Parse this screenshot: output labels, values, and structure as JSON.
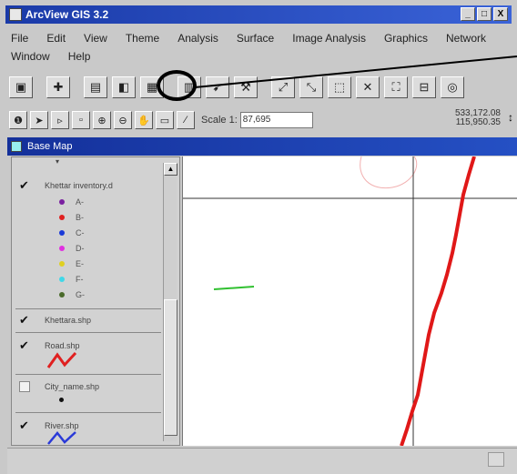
{
  "window": {
    "title": "ArcView GIS 3.2",
    "buttons": {
      "minimize": "_",
      "maximize": "□",
      "close": "X"
    }
  },
  "menu": [
    "File",
    "Edit",
    "View",
    "Theme",
    "Analysis",
    "Surface",
    "Image Analysis",
    "Graphics",
    "Network",
    "Window",
    "Help"
  ],
  "toolbar": {
    "buttons": [
      {
        "name": "save-icon",
        "glyph": "▣"
      },
      {
        "name": "add-theme-icon",
        "glyph": "✚"
      },
      {
        "name": "theme-properties-icon",
        "glyph": "▤"
      },
      {
        "name": "edit-legend-icon",
        "glyph": "◧"
      },
      {
        "name": "open-theme-table-icon",
        "glyph": "▦"
      },
      {
        "name": "find-icon",
        "glyph": "▥"
      },
      {
        "name": "locate-address-icon",
        "glyph": "➹"
      },
      {
        "name": "query-builder-icon",
        "glyph": "⚒"
      },
      {
        "name": "zoom-full-extent-icon",
        "glyph": "⤢"
      },
      {
        "name": "zoom-to-themes-icon",
        "glyph": "⤡"
      },
      {
        "name": "zoom-to-selected-icon",
        "glyph": "⬚"
      },
      {
        "name": "zoom-in-icon",
        "glyph": "✕"
      },
      {
        "name": "zoom-out-icon",
        "glyph": "⛶"
      },
      {
        "name": "zoom-previous-icon",
        "glyph": "⊟"
      },
      {
        "name": "select-none-icon",
        "glyph": "◎"
      }
    ]
  },
  "tools": [
    {
      "name": "identify-icon",
      "glyph": "❶"
    },
    {
      "name": "pointer-icon",
      "glyph": "➤"
    },
    {
      "name": "vertex-edit-icon",
      "glyph": "▹"
    },
    {
      "name": "select-feature-icon",
      "glyph": "▫"
    },
    {
      "name": "zoom-in-tool-icon",
      "glyph": "⊕"
    },
    {
      "name": "zoom-out-tool-icon",
      "glyph": "⊖"
    },
    {
      "name": "pan-icon",
      "glyph": "✋"
    },
    {
      "name": "measure-icon",
      "glyph": "▭"
    },
    {
      "name": "hotlink-icon",
      "glyph": "⁄"
    }
  ],
  "scale": {
    "label": "Scale 1:",
    "value": "87,695"
  },
  "coordinates": {
    "x": "533,172.08",
    "y": "115,950.35",
    "arrow": "↕"
  },
  "view": {
    "title": "Base Map"
  },
  "toc": {
    "themes": [
      {
        "name": "Khettar inventory.d",
        "checked": true,
        "classes": [
          {
            "label": "A-",
            "color": "#7a1fa0"
          },
          {
            "label": "B-",
            "color": "#e02020"
          },
          {
            "label": "C-",
            "color": "#1a3ad8"
          },
          {
            "label": "D-",
            "color": "#e030e0"
          },
          {
            "label": "E-",
            "color": "#e0d020"
          },
          {
            "label": "F-",
            "color": "#40d8e8"
          },
          {
            "label": "G-",
            "color": "#4a6a2a"
          }
        ]
      },
      {
        "name": "Khettara.shp",
        "checked": true
      },
      {
        "name": "Road.shp",
        "checked": true,
        "symbol_color": "#e02020"
      },
      {
        "name": "City_name.shp",
        "checked": false
      },
      {
        "name": "River.shp",
        "checked": true,
        "symbol_color": "#2a3ad8"
      }
    ]
  },
  "map": {
    "colors": {
      "road": "#e01818",
      "river_segment": "#30c030",
      "grid": "#333333",
      "faint_circle": "#f2b0b0"
    }
  }
}
